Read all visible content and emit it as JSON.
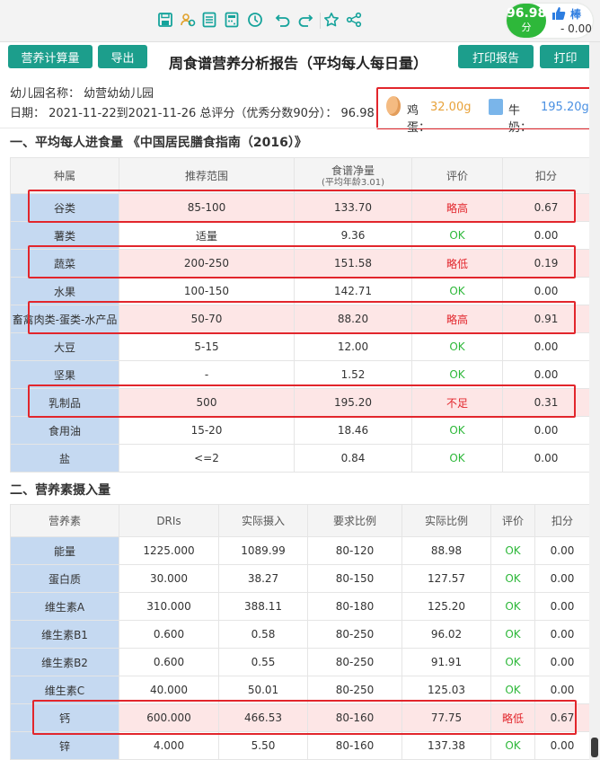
{
  "toolbar": {
    "icons": [
      "save-icon",
      "settings-people-icon",
      "list-icon",
      "calc-icon",
      "clock-icon",
      "undo-icon",
      "redo-icon",
      "star-icon",
      "share-icon"
    ]
  },
  "score": {
    "value": "96.98",
    "unit": "分",
    "badge": "棒",
    "deduct": "- 0.00"
  },
  "buttons": {
    "nutrition_calc": "营养计算量",
    "export": "导出",
    "print_report": "打印报告",
    "print": "打印"
  },
  "report": {
    "title": "周食谱营养分析报告（平均每人每日量）",
    "kindergarten": "幼儿园名称：  幼营幼幼儿园",
    "date_line": "日期：  2021-11-22到2021-11-26 总评分（优秀分数90分）：  96.98"
  },
  "extras": {
    "egg_label": "鸡蛋：",
    "egg_value": "32.00g",
    "milk_label": "牛奶：",
    "milk_value": "195.20g"
  },
  "section1": {
    "title": "一、平均每人进食量  《中国居民膳食指南（2016）》",
    "headers": [
      "种属",
      "推荐范围",
      "食谱净量",
      "(平均年龄3.01)",
      "评价",
      "扣分"
    ],
    "rows": [
      {
        "name": "谷类",
        "range": "85-100",
        "net": "133.70",
        "eval": "略高",
        "score": "0.67",
        "hl": true
      },
      {
        "name": "薯类",
        "range": "适量",
        "net": "9.36",
        "eval": "OK",
        "score": "0.00",
        "hl": false
      },
      {
        "name": "蔬菜",
        "range": "200-250",
        "net": "151.58",
        "eval": "略低",
        "score": "0.19",
        "hl": true
      },
      {
        "name": "水果",
        "range": "100-150",
        "net": "142.71",
        "eval": "OK",
        "score": "0.00",
        "hl": false
      },
      {
        "name": "畜禽肉类-蛋类-水产品",
        "range": "50-70",
        "net": "88.20",
        "eval": "略高",
        "score": "0.91",
        "hl": true
      },
      {
        "name": "大豆",
        "range": "5-15",
        "net": "12.00",
        "eval": "OK",
        "score": "0.00",
        "hl": false
      },
      {
        "name": "坚果",
        "range": "-",
        "net": "1.52",
        "eval": "OK",
        "score": "0.00",
        "hl": false
      },
      {
        "name": "乳制品",
        "range": "500",
        "net": "195.20",
        "eval": "不足",
        "score": "0.31",
        "hl": true
      },
      {
        "name": "食用油",
        "range": "15-20",
        "net": "18.46",
        "eval": "OK",
        "score": "0.00",
        "hl": false
      },
      {
        "name": "盐",
        "range": "<=2",
        "net": "0.84",
        "eval": "OK",
        "score": "0.00",
        "hl": false
      }
    ]
  },
  "section2": {
    "title": "二、营养素摄入量",
    "headers": [
      "营养素",
      "DRIs",
      "实际摄入",
      "要求比例",
      "实际比例",
      "评价",
      "扣分"
    ],
    "rows": [
      {
        "name": "能量",
        "dri": "1225.000",
        "actual": "1089.99",
        "req": "80-120",
        "ratio": "88.98",
        "eval": "OK",
        "score": "0.00",
        "hl": false
      },
      {
        "name": "蛋白质",
        "dri": "30.000",
        "actual": "38.27",
        "req": "80-150",
        "ratio": "127.57",
        "eval": "OK",
        "score": "0.00",
        "hl": false
      },
      {
        "name": "维生素A",
        "dri": "310.000",
        "actual": "388.11",
        "req": "80-180",
        "ratio": "125.20",
        "eval": "OK",
        "score": "0.00",
        "hl": false
      },
      {
        "name": "维生素B1",
        "dri": "0.600",
        "actual": "0.58",
        "req": "80-250",
        "ratio": "96.02",
        "eval": "OK",
        "score": "0.00",
        "hl": false
      },
      {
        "name": "维生素B2",
        "dri": "0.600",
        "actual": "0.55",
        "req": "80-250",
        "ratio": "91.91",
        "eval": "OK",
        "score": "0.00",
        "hl": false
      },
      {
        "name": "维生素C",
        "dri": "40.000",
        "actual": "50.01",
        "req": "80-250",
        "ratio": "125.03",
        "eval": "OK",
        "score": "0.00",
        "hl": false
      },
      {
        "name": "钙",
        "dri": "600.000",
        "actual": "466.53",
        "req": "80-160",
        "ratio": "77.75",
        "eval": "略低",
        "score": "0.67",
        "hl": true
      },
      {
        "name": "锌",
        "dri": "4.000",
        "actual": "5.50",
        "req": "80-160",
        "ratio": "137.38",
        "eval": "OK",
        "score": "0.00",
        "hl": false
      }
    ]
  },
  "colors": {
    "accent": "#1c9e8c",
    "warn": "#e2262c",
    "ok": "#2eb83a",
    "name_cell": "#c5d9f1",
    "highlight_row": "#fde6e6"
  }
}
